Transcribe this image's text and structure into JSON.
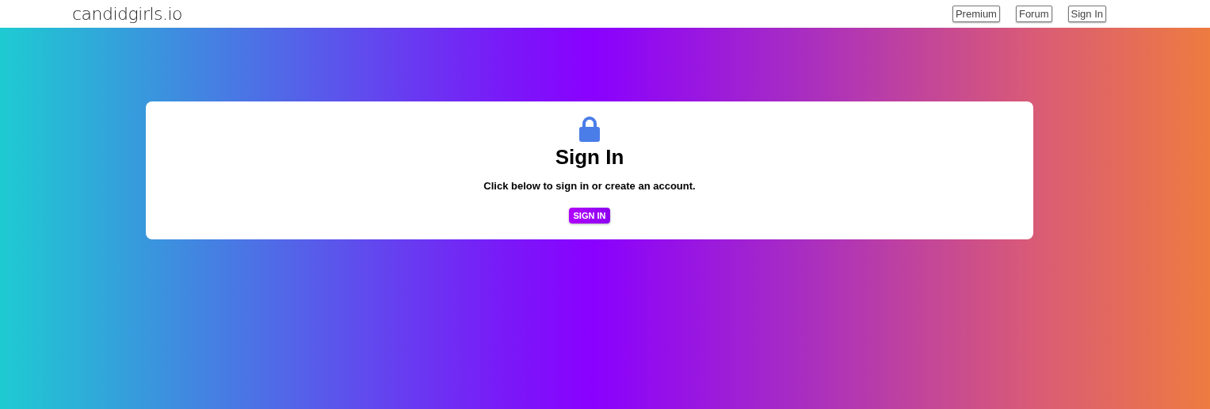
{
  "header": {
    "logo": "candidgirls.io",
    "nav": [
      "Premium",
      "Forum",
      "Sign In"
    ]
  },
  "card": {
    "title": "Sign In",
    "message": "Click below to sign in or create an account.",
    "button": "SIGN IN"
  }
}
